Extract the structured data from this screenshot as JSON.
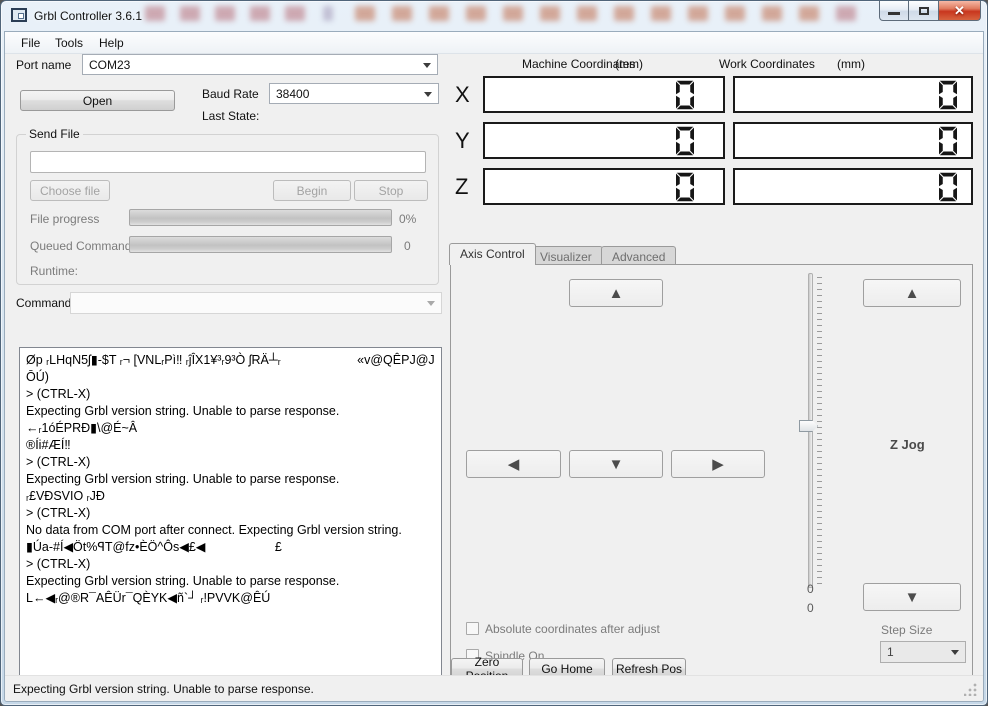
{
  "window": {
    "title": "Grbl Controller 3.6.1"
  },
  "menu": {
    "items": [
      {
        "label": "File"
      },
      {
        "label": "Tools"
      },
      {
        "label": "Help"
      }
    ]
  },
  "connection": {
    "port_label": "Port name",
    "port_value": "COM23",
    "open_button": "Open",
    "baud_label": "Baud Rate",
    "baud_value": "38400",
    "last_state_label": "Last State:"
  },
  "send_file": {
    "group_title": "Send File",
    "filename_value": "",
    "choose_file_button": "Choose file",
    "begin_button": "Begin",
    "stop_button": "Stop",
    "file_progress_label": "File progress",
    "file_progress_value": "0%",
    "queued_label": "Queued Commands",
    "queued_value": "0",
    "runtime_label": "Runtime:"
  },
  "command": {
    "label": "Command",
    "value": ""
  },
  "log": {
    "lines": [
      "Øp ᵣLHqN5ʃ▮-$T ᵣ¬ [VNLᵣPì‼ ᵣĵÎX1¥³ᵣ9³Ò ʃRÄ┴ᵣ                      «v@QÊPJ@JŌÚ)",
      "> (CTRL-X)",
      "Expecting Grbl version string. Unable to parse response.",
      "←ᵣ1óÉPRÐ▮\\@É~Â",
      "®Íi#ÆÍ‼",
      "> (CTRL-X)",
      "Expecting Grbl version string. Unable to parse response.",
      "ᵣ£VÐSVIO ᵣJÐ",
      "> (CTRL-X)",
      "No data from COM port after connect. Expecting Grbl version string.",
      "▮Úa-#Í◀Öt%ꟼT@fz•ÈÖ^Ôs◀£◀                    £",
      "> (CTRL-X)",
      "Expecting Grbl version string. Unable to parse response.",
      "L←◀ᵣ@®R¯AÊÜr¯QÈYK◀ñ`┘ ᵣ!PVVK@ÊÚ"
    ]
  },
  "coordinates": {
    "machine_header": "Machine Coordinates",
    "machine_units": "(mm)",
    "work_header": "Work Coordinates",
    "work_units": "(mm)",
    "axes": [
      {
        "label": "X",
        "machine": "0",
        "work": "0"
      },
      {
        "label": "Y",
        "machine": "0",
        "work": "0"
      },
      {
        "label": "Z",
        "machine": "0",
        "work": "0"
      }
    ]
  },
  "tabs": [
    {
      "label": "Axis Control",
      "active": true
    },
    {
      "label": "Visualizer",
      "active": false
    },
    {
      "label": "Advanced",
      "active": false
    }
  ],
  "axis_control": {
    "icons": {
      "up": "▲",
      "down": "▼",
      "left": "◀",
      "right": "▶"
    },
    "z_jog_label": "Z Jog",
    "slider_value_top": "0",
    "slider_value_bottom": "0",
    "absolute_checkbox_label": "Absolute coordinates after adjust",
    "spindle_checkbox_label": "Spindle On",
    "step_size_label": "Step Size",
    "step_size_value": "1"
  },
  "bottom_buttons": {
    "zero_position": "Zero Position",
    "go_home": "Go Home",
    "refresh_pos": "Refresh Pos"
  },
  "status_bar": {
    "text": "Expecting Grbl version string. Unable to parse response."
  },
  "colors": {
    "close_button": "#c8361e",
    "lcd_segment": "#161616",
    "frame_glass": "#d6e4f0"
  }
}
